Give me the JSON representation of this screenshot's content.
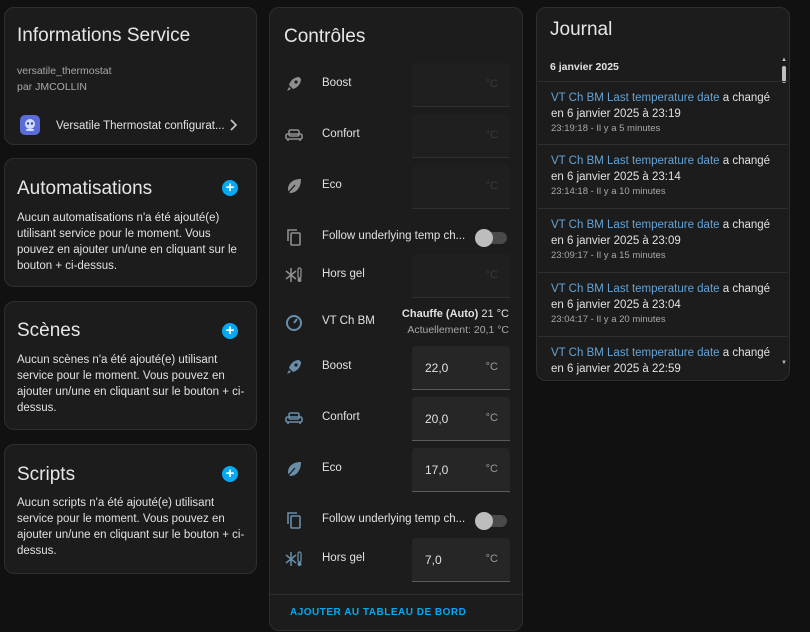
{
  "info": {
    "title": "Informations Service",
    "integration": "versatile_thermostat",
    "author": "par JMCOLLIN",
    "link_label": "Versatile Thermostat configurat..."
  },
  "automations": {
    "title": "Automatisations",
    "text": "Aucun automatisations n'a été ajouté(e) utilisant service pour le moment. Vous pouvez en ajouter un/une en cliquant sur le bouton + ci-dessus."
  },
  "scenes": {
    "title": "Scènes",
    "text": "Aucun scènes n'a été ajouté(e) utilisant service pour le moment. Vous pouvez en ajouter un/une en cliquant sur le bouton + ci-dessus."
  },
  "scripts": {
    "title": "Scripts",
    "text": "Aucun scripts n'a été ajouté(e) utilisant service pour le moment. Vous pouvez en ajouter un/une en cliquant sur le bouton + ci-dessus."
  },
  "controls": {
    "title": "Contrôles",
    "unit": "°C",
    "top": {
      "boost": {
        "label": "Boost",
        "value": ""
      },
      "confort": {
        "label": "Confort",
        "value": ""
      },
      "eco": {
        "label": "Eco",
        "value": ""
      },
      "follow": {
        "label": "Follow underlying temp ch..."
      },
      "horsgel": {
        "label": "Hors gel",
        "value": ""
      }
    },
    "climate": {
      "label": "VT Ch BM",
      "mode": "Chauffe (Auto)",
      "target": "21 °C",
      "current": "Actuellement: 20,1 °C"
    },
    "bottom": {
      "boost": {
        "label": "Boost",
        "value": "22,0"
      },
      "confort": {
        "label": "Confort",
        "value": "20,0"
      },
      "eco": {
        "label": "Eco",
        "value": "17,0"
      },
      "follow": {
        "label": "Follow underlying temp ch..."
      },
      "horsgel": {
        "label": "Hors gel",
        "value": "7,0"
      }
    },
    "add_button": "AJOUTER AU TABLEAU DE BORD"
  },
  "journal": {
    "title": "Journal",
    "date": "6 janvier 2025",
    "entries": [
      {
        "entity": "VT Ch BM Last temperature date",
        "action": "a changé",
        "value": "en 6 janvier 2025 à 23:19",
        "time": "23:19:18 - Il y a 5 minutes"
      },
      {
        "entity": "VT Ch BM Last temperature date",
        "action": "a changé",
        "value": "en 6 janvier 2025 à 23:14",
        "time": "23:14:18 - Il y a 10 minutes"
      },
      {
        "entity": "VT Ch BM Last temperature date",
        "action": "a changé",
        "value": "en 6 janvier 2025 à 23:09",
        "time": "23:09:17 - Il y a 15 minutes"
      },
      {
        "entity": "VT Ch BM Last temperature date",
        "action": "a changé",
        "value": "en 6 janvier 2025 à 23:04",
        "time": "23:04:17 - Il y a 20 minutes"
      },
      {
        "entity": "VT Ch BM Last temperature date",
        "action": "a changé",
        "value": "en 6 janvier 2025 à 22:59",
        "time": ""
      }
    ]
  },
  "colors": {
    "accent": "#03a9f4",
    "link": "#64a3d6",
    "card": "#1c1c1c",
    "background": "#111111"
  }
}
